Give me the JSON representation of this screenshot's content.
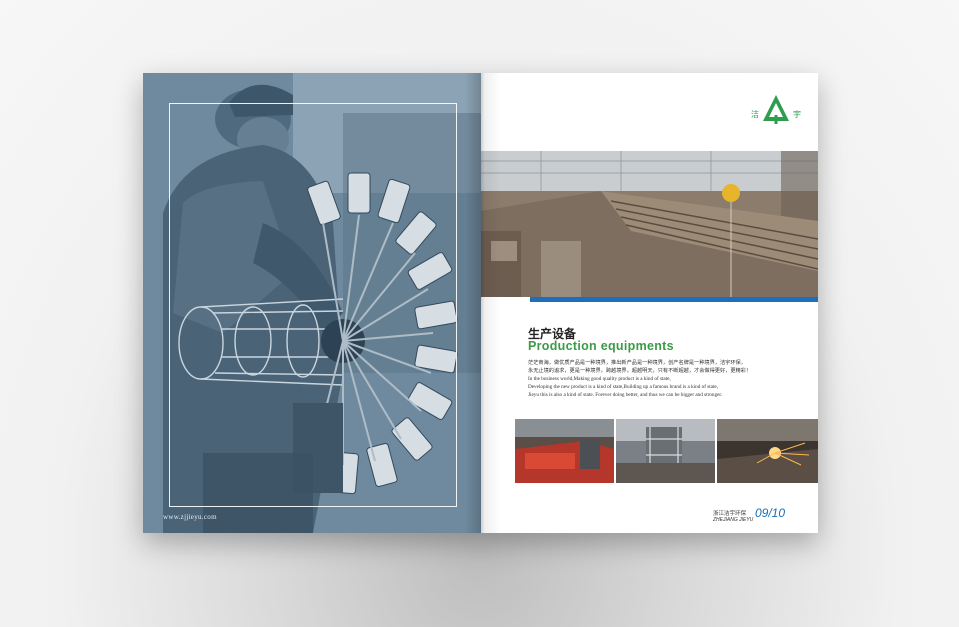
{
  "left_page": {
    "url": "www.zjjieyu.com",
    "photo_icon": "machine-worker-photo"
  },
  "right_page": {
    "logo": {
      "char_left": "洁",
      "char_right": "宇",
      "icon": "tree-logo-icon"
    },
    "hero_icon": "steel-factory-photo",
    "section_title_cn": "生产设备",
    "section_title_en": "Production equipments",
    "body_lines": [
      "茫茫商海，做优质产品是一种境界，推出新产品是一种境界，创产名牌是一种境界，洁宇环保，",
      "永无止境的追求，更是一种境界，跨越境界，超越明天，只有不断超越，才会做得更好，更精彩！",
      "In the business world,Making good quality product is a kind of state,",
      "Developing the new product is a kind of state,Building up a famous brand is a kind of state,",
      "Jieyu this is also a kind of state. Forever doing better, and thus we can be bigger and stronger."
    ],
    "thumbnails": [
      "welding-machine-photo",
      "workshop-gantry-photo",
      "cutting-sparks-photo"
    ],
    "footer": {
      "company_cn": "浙江洁宇环保",
      "company_en": "ZHEJIANG JIEYU",
      "page_number": "09/10"
    }
  },
  "colors": {
    "accent_blue": "#1c6fbd",
    "accent_green": "#3a9b47"
  }
}
